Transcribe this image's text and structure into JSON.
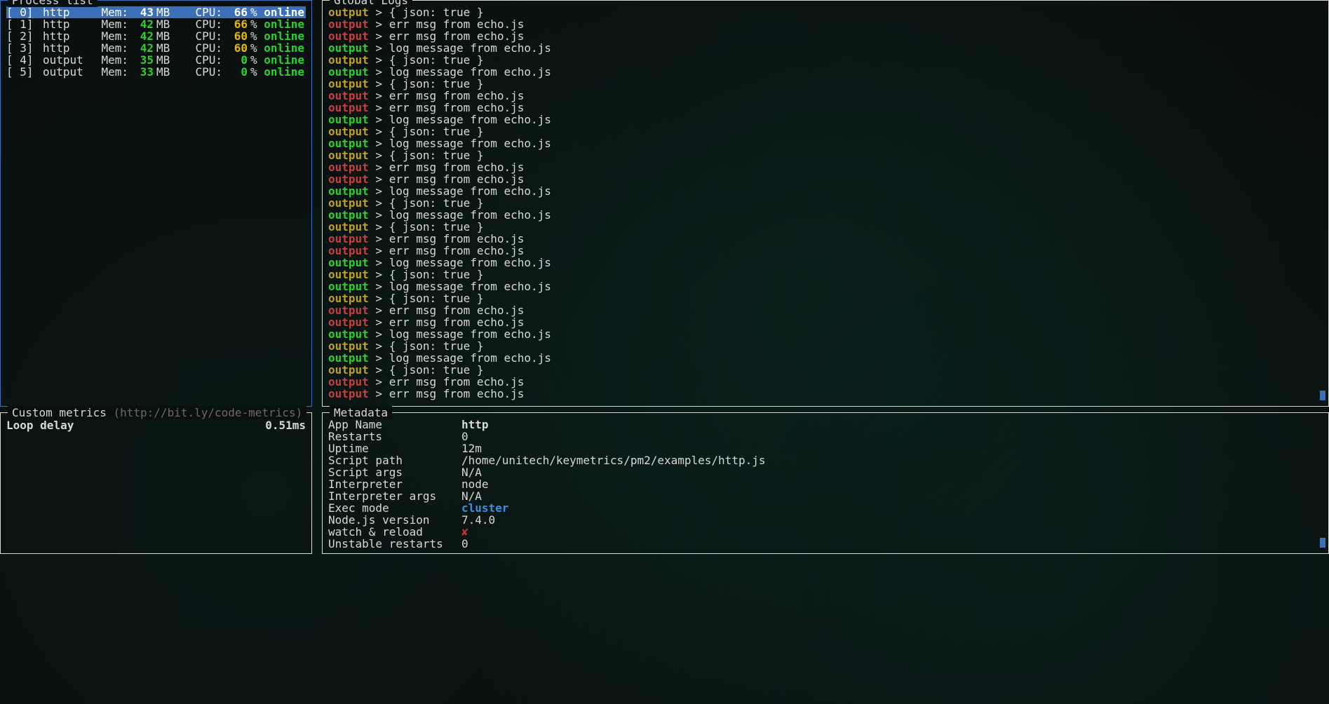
{
  "panels": {
    "process_title": "Process list",
    "logs_title": "Global Logs",
    "metrics_title": "Custom metrics",
    "metrics_hint": "(http://bit.ly/code-metrics)",
    "meta_title": "Metadata"
  },
  "processes": [
    {
      "id": "[ 0]",
      "name": "http",
      "mem": "43",
      "mem_unit": "MB",
      "cpu": "66",
      "status": "online",
      "cpu_hi": true,
      "selected": true
    },
    {
      "id": "[ 1]",
      "name": "http",
      "mem": "42",
      "mem_unit": "MB",
      "cpu": "66",
      "status": "online",
      "cpu_hi": true,
      "selected": false
    },
    {
      "id": "[ 2]",
      "name": "http",
      "mem": "42",
      "mem_unit": "MB",
      "cpu": "60",
      "status": "online",
      "cpu_hi": true,
      "selected": false
    },
    {
      "id": "[ 3]",
      "name": "http",
      "mem": "42",
      "mem_unit": "MB",
      "cpu": "60",
      "status": "online",
      "cpu_hi": true,
      "selected": false
    },
    {
      "id": "[ 4]",
      "name": "output",
      "mem": "35",
      "mem_unit": "MB",
      "cpu": "0",
      "status": "online",
      "cpu_hi": false,
      "selected": false
    },
    {
      "id": "[ 5]",
      "name": "output",
      "mem": "33",
      "mem_unit": "MB",
      "cpu": "0",
      "status": "online",
      "cpu_hi": false,
      "selected": false
    }
  ],
  "proc_labels": {
    "mem": "Mem:",
    "cpu": "CPU:",
    "pct": "%"
  },
  "logs": [
    {
      "src": "warn",
      "msg": "{ json: true }"
    },
    {
      "src": "err",
      "msg": "err msg from echo.js"
    },
    {
      "src": "err",
      "msg": "err msg from echo.js"
    },
    {
      "src": "out",
      "msg": "log message from echo.js"
    },
    {
      "src": "warn",
      "msg": "{ json: true }"
    },
    {
      "src": "out",
      "msg": "log message from echo.js"
    },
    {
      "src": "warn",
      "msg": "{ json: true }"
    },
    {
      "src": "err",
      "msg": "err msg from echo.js"
    },
    {
      "src": "err",
      "msg": "err msg from echo.js"
    },
    {
      "src": "out",
      "msg": "log message from echo.js"
    },
    {
      "src": "warn",
      "msg": "{ json: true }"
    },
    {
      "src": "out",
      "msg": "log message from echo.js"
    },
    {
      "src": "warn",
      "msg": "{ json: true }"
    },
    {
      "src": "err",
      "msg": "err msg from echo.js"
    },
    {
      "src": "err",
      "msg": "err msg from echo.js"
    },
    {
      "src": "out",
      "msg": "log message from echo.js"
    },
    {
      "src": "warn",
      "msg": "{ json: true }"
    },
    {
      "src": "out",
      "msg": "log message from echo.js"
    },
    {
      "src": "warn",
      "msg": "{ json: true }"
    },
    {
      "src": "err",
      "msg": "err msg from echo.js"
    },
    {
      "src": "err",
      "msg": "err msg from echo.js"
    },
    {
      "src": "out",
      "msg": "log message from echo.js"
    },
    {
      "src": "warn",
      "msg": "{ json: true }"
    },
    {
      "src": "out",
      "msg": "log message from echo.js"
    },
    {
      "src": "warn",
      "msg": "{ json: true }"
    },
    {
      "src": "err",
      "msg": "err msg from echo.js"
    },
    {
      "src": "err",
      "msg": "err msg from echo.js"
    },
    {
      "src": "out",
      "msg": "log message from echo.js"
    },
    {
      "src": "warn",
      "msg": "{ json: true }"
    },
    {
      "src": "out",
      "msg": "log message from echo.js"
    },
    {
      "src": "warn",
      "msg": "{ json: true }"
    },
    {
      "src": "err",
      "msg": "err msg from echo.js"
    },
    {
      "src": "err",
      "msg": "err msg from echo.js"
    }
  ],
  "log_prefix": "output",
  "log_separator": " > ",
  "metrics": {
    "loop_delay_label": "Loop delay",
    "loop_delay_value": "0.51ms"
  },
  "metadata": [
    {
      "label": "App Name",
      "value": "http",
      "cls": "bold"
    },
    {
      "label": "Restarts",
      "value": "0",
      "cls": ""
    },
    {
      "label": "Uptime",
      "value": "12m",
      "cls": ""
    },
    {
      "label": "Script path",
      "value": "/home/unitech/keymetrics/pm2/examples/http.js",
      "cls": ""
    },
    {
      "label": "Script args",
      "value": "N/A",
      "cls": ""
    },
    {
      "label": "Interpreter",
      "value": "node",
      "cls": ""
    },
    {
      "label": "Interpreter args",
      "value": "N/A",
      "cls": ""
    },
    {
      "label": "Exec mode",
      "value": "cluster",
      "cls": "blue"
    },
    {
      "label": "Node.js version",
      "value": "7.4.0",
      "cls": ""
    },
    {
      "label": "watch & reload",
      "value": "✘",
      "cls": "redx"
    },
    {
      "label": "Unstable restarts",
      "value": "0",
      "cls": ""
    }
  ]
}
